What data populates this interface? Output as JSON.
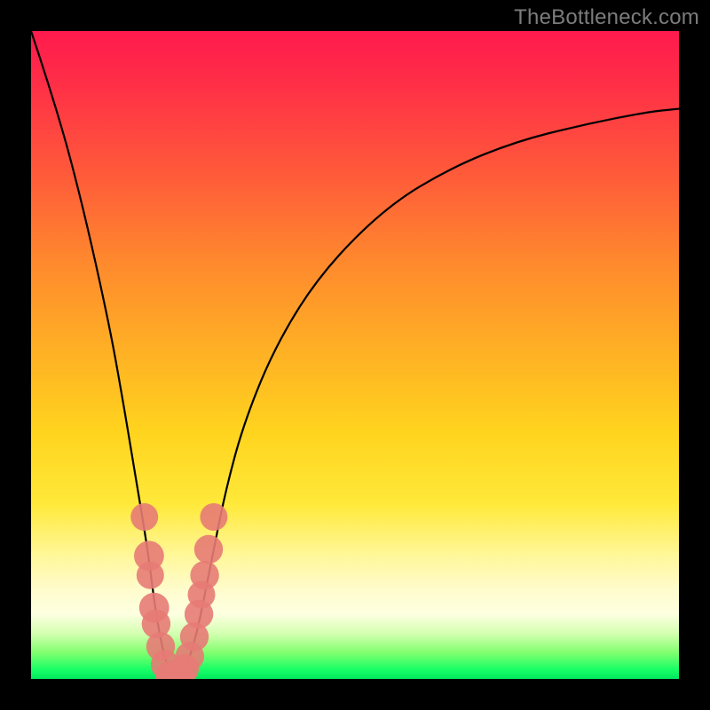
{
  "watermark": "TheBottleneck.com",
  "chart_data": {
    "type": "line",
    "title": "",
    "xlabel": "",
    "ylabel": "",
    "xlim": [
      0,
      100
    ],
    "ylim": [
      0,
      100
    ],
    "grid": false,
    "legend": false,
    "background_gradient": {
      "direction": "vertical",
      "stops": [
        {
          "pct": 0,
          "color": "#ff1a4d"
        },
        {
          "pct": 22,
          "color": "#ff5a3a"
        },
        {
          "pct": 50,
          "color": "#ffb224"
        },
        {
          "pct": 73,
          "color": "#ffe93a"
        },
        {
          "pct": 88,
          "color": "#fdffe0"
        },
        {
          "pct": 100,
          "color": "#00e85e"
        }
      ]
    },
    "series": [
      {
        "name": "bottleneck-curve",
        "x": [
          0,
          4,
          8,
          12,
          14,
          16,
          18,
          19,
          20,
          21,
          22,
          23,
          24,
          25,
          26,
          27,
          28,
          30,
          33,
          38,
          45,
          55,
          65,
          75,
          85,
          95,
          100
        ],
        "y": [
          100,
          88,
          73,
          55,
          44,
          32,
          20,
          12,
          6,
          2,
          0,
          0.5,
          2,
          5,
          9,
          14,
          19,
          29,
          40,
          52,
          63,
          73,
          79,
          83,
          85.5,
          87.5,
          88
        ]
      }
    ],
    "markers": {
      "name": "highlighted-points",
      "color": "#e77b76",
      "points": [
        {
          "x": 17.5,
          "y": 25,
          "r": 1.3
        },
        {
          "x": 18.2,
          "y": 19,
          "r": 1.5
        },
        {
          "x": 18.4,
          "y": 16,
          "r": 1.3
        },
        {
          "x": 19.0,
          "y": 11,
          "r": 1.5
        },
        {
          "x": 19.3,
          "y": 8.5,
          "r": 1.4
        },
        {
          "x": 20.0,
          "y": 5,
          "r": 1.4
        },
        {
          "x": 20.7,
          "y": 2.2,
          "r": 1.4
        },
        {
          "x": 21.5,
          "y": 0.5,
          "r": 1.5
        },
        {
          "x": 22.3,
          "y": 0.2,
          "r": 1.5
        },
        {
          "x": 23.0,
          "y": 0.6,
          "r": 1.5
        },
        {
          "x": 23.7,
          "y": 1.6,
          "r": 1.4
        },
        {
          "x": 24.5,
          "y": 3.5,
          "r": 1.4
        },
        {
          "x": 25.2,
          "y": 6.5,
          "r": 1.4
        },
        {
          "x": 25.9,
          "y": 10,
          "r": 1.4
        },
        {
          "x": 26.3,
          "y": 13,
          "r": 1.3
        },
        {
          "x": 26.8,
          "y": 16,
          "r": 1.4
        },
        {
          "x": 27.4,
          "y": 20,
          "r": 1.4
        },
        {
          "x": 28.2,
          "y": 25,
          "r": 1.3
        }
      ]
    }
  }
}
